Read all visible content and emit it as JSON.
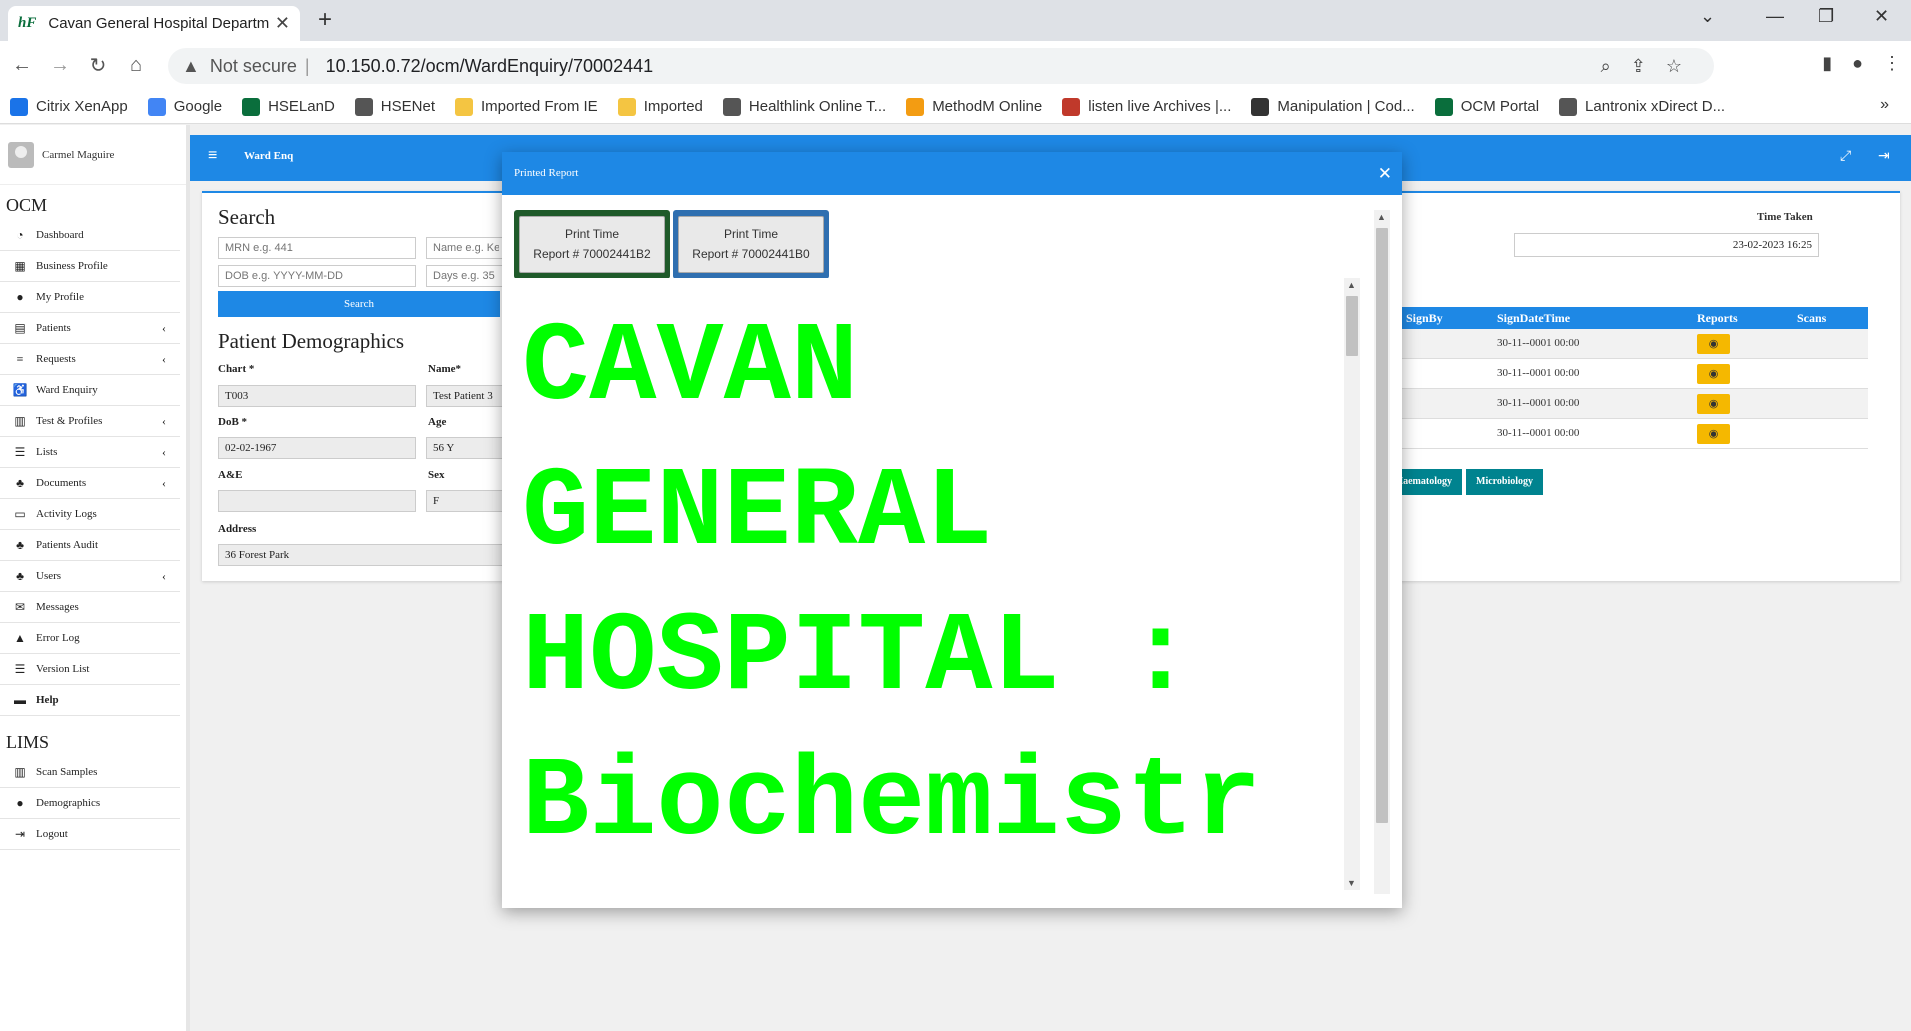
{
  "browser": {
    "tab_title": "Cavan General Hospital Departm",
    "tab_favicon": "hF",
    "url_prefix": "Not secure",
    "url": "10.150.0.72/ocm/WardEnquiry/70002441"
  },
  "bookmarks": [
    {
      "label": "Citrix XenApp",
      "icon": "citrix-icon",
      "color": "#1a73e8"
    },
    {
      "label": "Google",
      "icon": "google-icon",
      "color": "#4285f4"
    },
    {
      "label": "HSELanD",
      "icon": "hse-icon",
      "color": "#0a6e3c"
    },
    {
      "label": "HSENet",
      "icon": "globe-icon",
      "color": "#555555"
    },
    {
      "label": "Imported From IE",
      "icon": "folder-icon",
      "color": "#f4c542"
    },
    {
      "label": "Imported",
      "icon": "folder-icon",
      "color": "#f4c542"
    },
    {
      "label": "Healthlink Online T...",
      "icon": "globe-icon",
      "color": "#555555"
    },
    {
      "label": "MethodM Online",
      "icon": "methodm-icon",
      "color": "#f39c12"
    },
    {
      "label": "listen live Archives |...",
      "icon": "nt-icon",
      "color": "#c0392b"
    },
    {
      "label": "Manipulation | Cod...",
      "icon": "code-icon",
      "color": "#333333"
    },
    {
      "label": "OCM Portal",
      "icon": "hse-icon",
      "color": "#0a6e3c"
    },
    {
      "label": "Lantronix xDirect D...",
      "icon": "globe-icon",
      "color": "#555555"
    }
  ],
  "sidebar": {
    "user_name": "Carmel Maguire",
    "section_ocm": "OCM",
    "ocm_items": [
      {
        "label": "Dashboard",
        "icon": "dashboard-icon",
        "glyph": "◔",
        "chevron": false
      },
      {
        "label": "Business Profile",
        "icon": "building-icon",
        "glyph": "▦",
        "chevron": false
      },
      {
        "label": "My Profile",
        "icon": "user-icon",
        "glyph": "●",
        "chevron": false
      },
      {
        "label": "Patients",
        "icon": "patients-icon",
        "glyph": "▤",
        "chevron": true
      },
      {
        "label": "Requests",
        "icon": "database-icon",
        "glyph": "≡",
        "chevron": true
      },
      {
        "label": "Ward Enquiry",
        "icon": "wheelchair-icon",
        "glyph": "♿",
        "chevron": false
      },
      {
        "label": "Test & Profiles",
        "icon": "test-icon",
        "glyph": "▥",
        "chevron": true
      },
      {
        "label": "Lists",
        "icon": "list-icon",
        "glyph": "☰",
        "chevron": true
      },
      {
        "label": "Documents",
        "icon": "users-icon",
        "glyph": "♣",
        "chevron": true
      },
      {
        "label": "Activity Logs",
        "icon": "log-icon",
        "glyph": "▭",
        "chevron": false
      },
      {
        "label": "Patients Audit",
        "icon": "users-icon",
        "glyph": "♣",
        "chevron": false
      },
      {
        "label": "Users",
        "icon": "users-icon",
        "glyph": "♣",
        "chevron": true
      },
      {
        "label": "Messages",
        "icon": "envelope-icon",
        "glyph": "✉",
        "chevron": false
      },
      {
        "label": "Error Log",
        "icon": "warning-icon",
        "glyph": "▲",
        "chevron": false
      },
      {
        "label": "Version List",
        "icon": "list-icon",
        "glyph": "☰",
        "chevron": false
      },
      {
        "label": "Help",
        "icon": "keyboard-icon",
        "glyph": "▬",
        "chevron": false
      }
    ],
    "section_lims": "LIMS",
    "lims_items": [
      {
        "label": "Scan Samples",
        "icon": "barcode-icon",
        "glyph": "▥"
      },
      {
        "label": "Demographics",
        "icon": "user-icon",
        "glyph": "●"
      },
      {
        "label": "Logout",
        "icon": "logout-icon",
        "glyph": "⇥"
      }
    ]
  },
  "header": {
    "title": "Ward Enq"
  },
  "search": {
    "heading": "Search",
    "mrn_placeholder": "MRN e.g. 441",
    "name_placeholder": "Name e.g. Ken",
    "dob_placeholder": "DOB e.g. YYYY-MM-DD",
    "days_placeholder": "Days e.g. 35",
    "button": "Search"
  },
  "demographics": {
    "heading": "Patient Demographics",
    "chart_label": "Chart *",
    "chart_value": "T003",
    "name_label": "Name*",
    "name_value": "Test Patient 3",
    "dob_label": "DoB *",
    "dob_value": "02-02-1967",
    "age_label": "Age",
    "age_value": "56 Y",
    "ae_label": "A&E",
    "ae_value": "",
    "sex_label": "Sex",
    "sex_value": "F",
    "address_label": "Address",
    "address_value": "36 Forest Park"
  },
  "time_taken": {
    "label": "Time Taken",
    "value": "23-02-2023 16:25"
  },
  "reports_grid": {
    "columns": [
      "SignBy",
      "SignDateTime",
      "Reports",
      "Scans"
    ],
    "rows": [
      {
        "sign_by": "",
        "sign_datetime": "30-11--0001 00:00"
      },
      {
        "sign_by": "",
        "sign_datetime": "30-11--0001 00:00"
      },
      {
        "sign_by": "",
        "sign_datetime": "30-11--0001 00:00"
      },
      {
        "sign_by": "",
        "sign_datetime": "30-11--0001 00:00"
      }
    ]
  },
  "dept_tabs": [
    "Haematology",
    "Microbiology"
  ],
  "modal": {
    "title": "Printed Report",
    "buttons": [
      {
        "line1": "Print Time",
        "line2": "Report # 70002441B2"
      },
      {
        "line1": "Print Time",
        "line2": "Report # 70002441B0"
      }
    ],
    "report_lines": [
      "CAVAN",
      "GENERAL",
      "HOSPITAL :",
      "Biochemistr"
    ],
    "report_color": "#00ff00"
  },
  "colors": {
    "primary": "#1e88e5",
    "warning": "#f5b800",
    "teal": "#00838f"
  }
}
